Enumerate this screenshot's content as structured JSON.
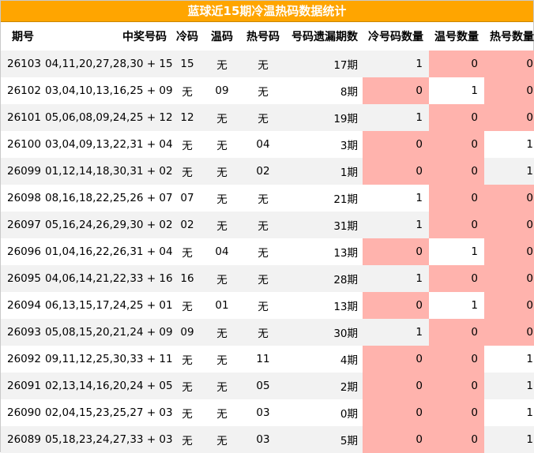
{
  "title": "蓝球近15期冷温热码数据统计",
  "columns": [
    "期号",
    "中奖号码",
    "冷码",
    "温码",
    "热号码",
    "号码遗漏期数",
    "冷号码数量",
    "温号数量",
    "热号数量"
  ],
  "colors": {
    "header_bg": "#ffa500",
    "highlight": "#ffb3ad",
    "stripe": "#f2f2f2"
  },
  "rows": [
    {
      "issue": "26103",
      "nums": "04,11,20,27,28,30 + 15",
      "cold": "15",
      "warm": "无",
      "hot": "无",
      "miss": "17期",
      "cold_count": "1",
      "warm_count": "0",
      "hot_count": "0"
    },
    {
      "issue": "26102",
      "nums": "03,04,10,13,16,25 + 09",
      "cold": "无",
      "warm": "09",
      "hot": "无",
      "miss": "8期",
      "cold_count": "0",
      "warm_count": "1",
      "hot_count": "0"
    },
    {
      "issue": "26101",
      "nums": "05,06,08,09,24,25 + 12",
      "cold": "12",
      "warm": "无",
      "hot": "无",
      "miss": "19期",
      "cold_count": "1",
      "warm_count": "0",
      "hot_count": "0"
    },
    {
      "issue": "26100",
      "nums": "03,04,09,13,22,31 + 04",
      "cold": "无",
      "warm": "无",
      "hot": "04",
      "miss": "3期",
      "cold_count": "0",
      "warm_count": "0",
      "hot_count": "1"
    },
    {
      "issue": "26099",
      "nums": "01,12,14,18,30,31 + 02",
      "cold": "无",
      "warm": "无",
      "hot": "02",
      "miss": "1期",
      "cold_count": "0",
      "warm_count": "0",
      "hot_count": "1"
    },
    {
      "issue": "26098",
      "nums": "08,16,18,22,25,26 + 07",
      "cold": "07",
      "warm": "无",
      "hot": "无",
      "miss": "21期",
      "cold_count": "1",
      "warm_count": "0",
      "hot_count": "0"
    },
    {
      "issue": "26097",
      "nums": "05,16,24,26,29,30 + 02",
      "cold": "02",
      "warm": "无",
      "hot": "无",
      "miss": "31期",
      "cold_count": "1",
      "warm_count": "0",
      "hot_count": "0"
    },
    {
      "issue": "26096",
      "nums": "01,04,16,22,26,31 + 04",
      "cold": "无",
      "warm": "04",
      "hot": "无",
      "miss": "13期",
      "cold_count": "0",
      "warm_count": "1",
      "hot_count": "0"
    },
    {
      "issue": "26095",
      "nums": "04,06,14,21,22,33 + 16",
      "cold": "16",
      "warm": "无",
      "hot": "无",
      "miss": "28期",
      "cold_count": "1",
      "warm_count": "0",
      "hot_count": "0"
    },
    {
      "issue": "26094",
      "nums": "06,13,15,17,24,25 + 01",
      "cold": "无",
      "warm": "01",
      "hot": "无",
      "miss": "13期",
      "cold_count": "0",
      "warm_count": "1",
      "hot_count": "0"
    },
    {
      "issue": "26093",
      "nums": "05,08,15,20,21,24 + 09",
      "cold": "09",
      "warm": "无",
      "hot": "无",
      "miss": "30期",
      "cold_count": "1",
      "warm_count": "0",
      "hot_count": "0"
    },
    {
      "issue": "26092",
      "nums": "09,11,12,25,30,33 + 11",
      "cold": "无",
      "warm": "无",
      "hot": "11",
      "miss": "4期",
      "cold_count": "0",
      "warm_count": "0",
      "hot_count": "1"
    },
    {
      "issue": "26091",
      "nums": "02,13,14,16,20,24 + 05",
      "cold": "无",
      "warm": "无",
      "hot": "05",
      "miss": "2期",
      "cold_count": "0",
      "warm_count": "0",
      "hot_count": "1"
    },
    {
      "issue": "26090",
      "nums": "02,04,15,23,25,27 + 03",
      "cold": "无",
      "warm": "无",
      "hot": "03",
      "miss": "0期",
      "cold_count": "0",
      "warm_count": "0",
      "hot_count": "1"
    },
    {
      "issue": "26089",
      "nums": "05,18,23,24,27,33 + 03",
      "cold": "无",
      "warm": "无",
      "hot": "03",
      "miss": "5期",
      "cold_count": "0",
      "warm_count": "0",
      "hot_count": "1"
    }
  ]
}
